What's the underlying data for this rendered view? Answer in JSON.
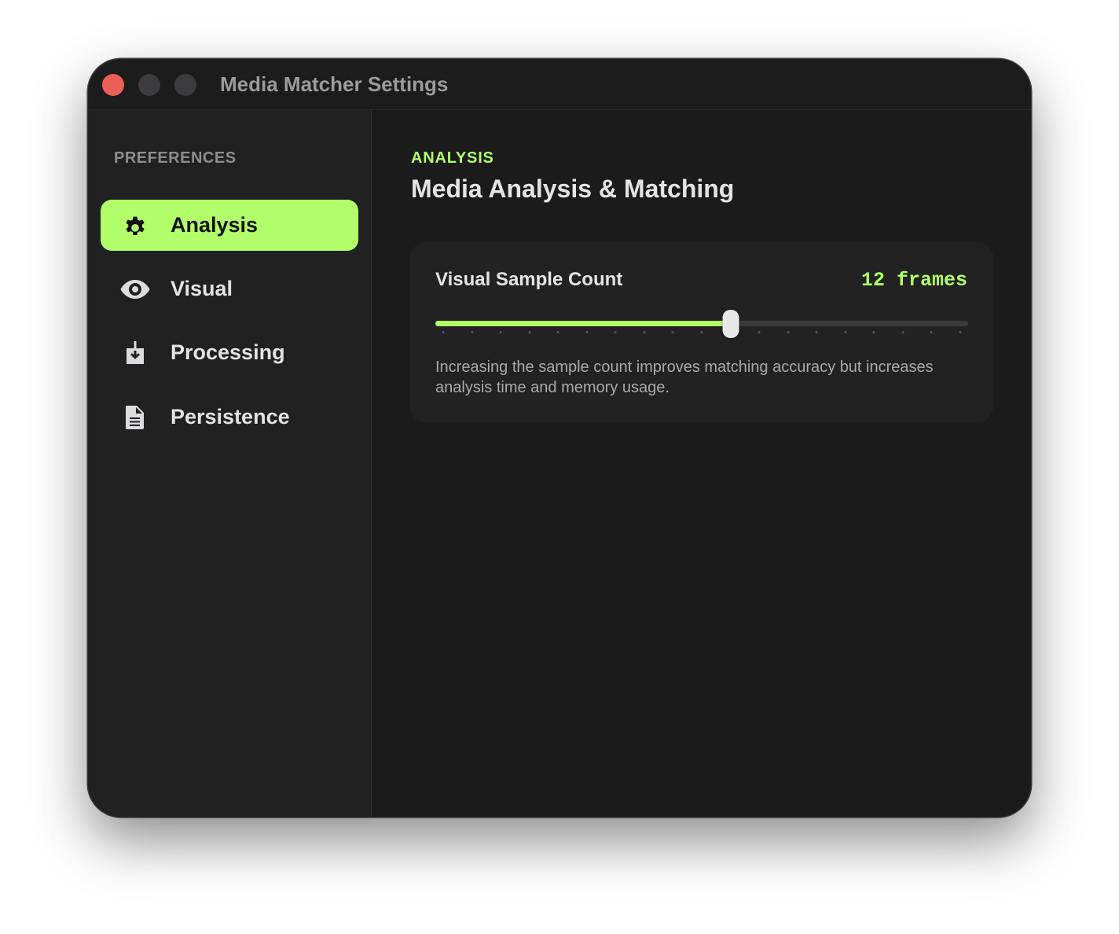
{
  "window": {
    "title": "Media Matcher Settings"
  },
  "sidebar": {
    "header": "PREFERENCES",
    "items": [
      {
        "label": "Analysis",
        "icon": "gear-icon",
        "active": true
      },
      {
        "label": "Visual",
        "icon": "eye-icon",
        "active": false
      },
      {
        "label": "Processing",
        "icon": "download-tray-icon",
        "active": false
      },
      {
        "label": "Persistence",
        "icon": "document-icon",
        "active": false
      }
    ]
  },
  "main": {
    "eyebrow": "ANALYSIS",
    "title": "Media Analysis & Matching",
    "setting": {
      "label": "Visual Sample Count",
      "value_text": "12 frames",
      "slider": {
        "min": 2,
        "max": 20,
        "value": 12,
        "step": 1
      },
      "description": "Increasing the sample count improves matching accuracy but increases analysis time and memory usage."
    }
  },
  "colors": {
    "accent": "#b1fe6a",
    "window_bg": "#1b1b1c",
    "sidebar_bg": "#212122",
    "close_button": "#ec5f57"
  }
}
